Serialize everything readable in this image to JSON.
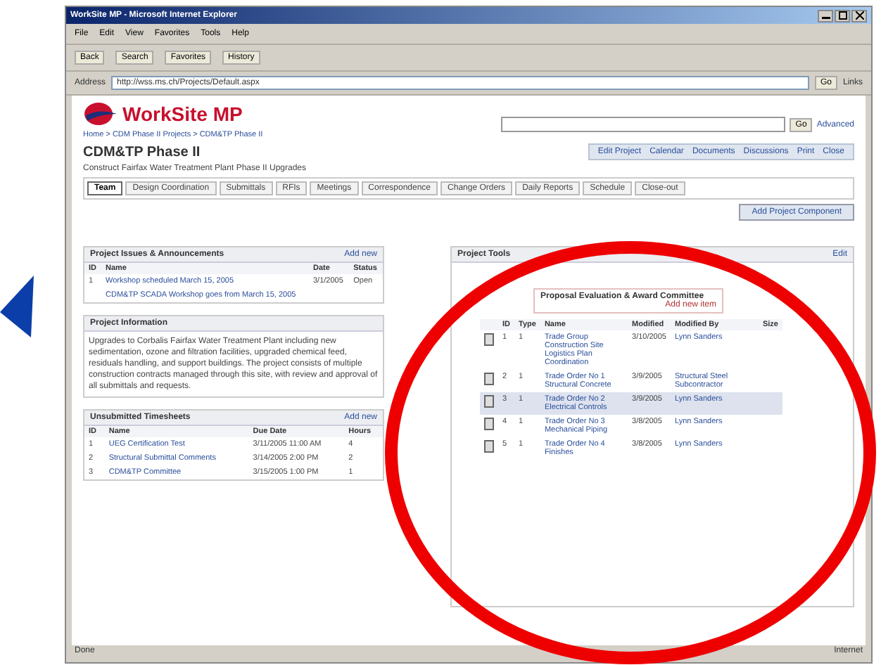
{
  "window": {
    "title": "WorkSite MP - Microsoft Internet Explorer"
  },
  "menu": [
    "File",
    "Edit",
    "View",
    "Favorites",
    "Tools",
    "Help"
  ],
  "toolbar": [
    "Back",
    "Search",
    "Favorites",
    "History"
  ],
  "address": {
    "label": "Address",
    "value": "http://wss.ms.ch/Projects/Default.aspx",
    "go": "Go",
    "links": "Links"
  },
  "logo": "WorkSite MP",
  "search": {
    "button": "Go",
    "link": "Advanced"
  },
  "breadcrumb": "Home > CDM Phase II Projects > CDM&TP Phase II",
  "page_title": "CDM&TP Phase II",
  "actions": [
    "Edit Project",
    "Calendar",
    "Documents",
    "Discussions",
    "Print",
    "Close"
  ],
  "description": "Construct Fairfax Water Treatment Plant Phase II Upgrades",
  "tabs": [
    {
      "label": "Team",
      "selected": true
    },
    {
      "label": "Design Coordination",
      "selected": false
    },
    {
      "label": "Submittals",
      "selected": false
    },
    {
      "label": "RFIs",
      "selected": false
    },
    {
      "label": "Meetings",
      "selected": false
    },
    {
      "label": "Correspondence",
      "selected": false
    },
    {
      "label": "Change Orders",
      "selected": false
    },
    {
      "label": "Daily Reports",
      "selected": false
    },
    {
      "label": "Schedule",
      "selected": false
    },
    {
      "label": "Close-out",
      "selected": false
    }
  ],
  "add_button": "Add Project Component",
  "left_panels": [
    {
      "title": "Project Issues & Announcements",
      "link": "Add new",
      "columns": [
        "ID",
        "Name",
        "Date",
        "Status"
      ],
      "rows": [
        {
          "cells": [
            "1",
            "Workshop scheduled March 15, 2005",
            "3/1/2005",
            "Open"
          ]
        },
        {
          "cells": [
            "",
            "CDM&TP SCADA Workshop goes from March 15, 2005",
            "",
            ""
          ]
        }
      ]
    },
    {
      "title": "Project Information",
      "text": "Upgrades to Corbalis Fairfax Water Treatment Plant including new sedimentation, ozone and filtration facilities, upgraded chemical feed, residuals handling, and support buildings. The project consists of multiple construction contracts managed through this site, with review and approval of all submittals and requests."
    },
    {
      "title": "Unsubmitted Timesheets",
      "link": "Add new",
      "columns": [
        "ID",
        "Name",
        "Due Date",
        "Hours"
      ],
      "rows": [
        {
          "cells": [
            "1",
            "UEG Certification Test",
            "3/11/2005 11:00 AM",
            "4"
          ]
        },
        {
          "cells": [
            "2",
            "Structural Submittal Comments",
            "3/14/2005 2:00 PM",
            "2"
          ]
        },
        {
          "cells": [
            "3",
            "CDM&TP Committee",
            "3/15/2005 1:00 PM",
            "1"
          ]
        }
      ]
    }
  ],
  "right_panel": {
    "title": "Project Tools",
    "link": "Edit",
    "sub_title": "Proposal Evaluation & Award Committee",
    "sub_link": "Add new item",
    "columns": [
      "ID",
      "Type",
      "Name",
      "Modified",
      "Modified By",
      "Size"
    ],
    "rows": [
      {
        "selected": false,
        "cells": [
          "1",
          "1",
          "Trade Group Construction Site Logistics Plan Coordination",
          "3/10/2005",
          "Lynn Sanders"
        ]
      },
      {
        "selected": false,
        "cells": [
          "2",
          "1",
          "Trade Order No 1 Structural Concrete",
          "3/9/2005",
          "Structural Steel Subcontractor"
        ]
      },
      {
        "selected": true,
        "cells": [
          "3",
          "1",
          "Trade Order No 2 Electrical Controls",
          "3/9/2005",
          "Lynn Sanders"
        ]
      },
      {
        "selected": false,
        "cells": [
          "4",
          "1",
          "Trade Order No 3 Mechanical Piping",
          "3/8/2005",
          "Lynn Sanders"
        ]
      },
      {
        "selected": false,
        "cells": [
          "5",
          "1",
          "Trade Order No 4 Finishes",
          "3/8/2005",
          "Lynn Sanders"
        ]
      }
    ]
  },
  "status": {
    "text": "Done",
    "zone": "Internet"
  }
}
